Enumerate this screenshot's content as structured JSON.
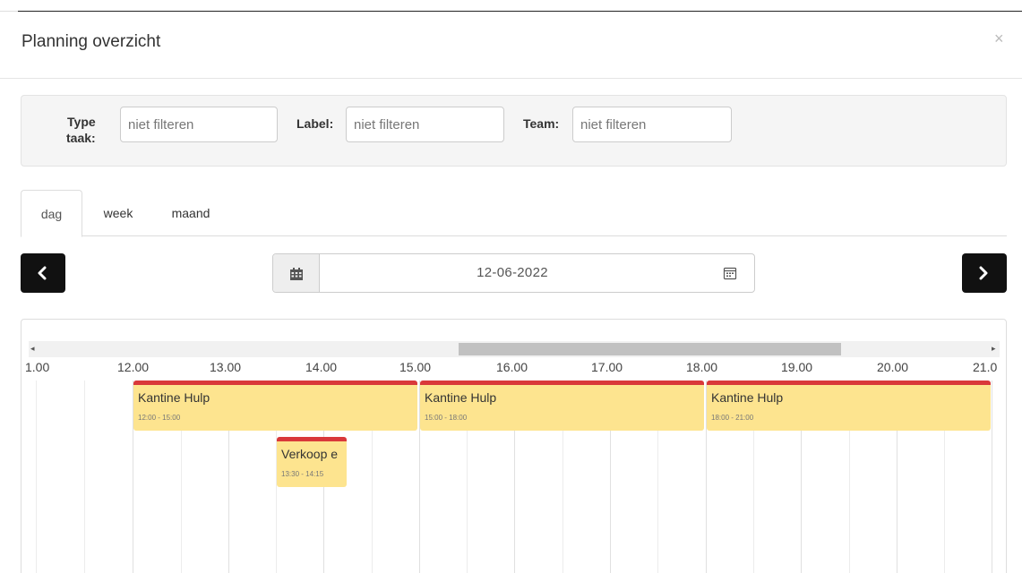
{
  "modal": {
    "title": "Planning overzicht",
    "close_glyph": "×"
  },
  "filters": {
    "type_label_line1": "Type",
    "type_label_line2": "taak:",
    "type_placeholder": "niet filteren",
    "label_label": "Label:",
    "label_placeholder": "niet filteren",
    "team_label": "Team:",
    "team_placeholder": "niet filteren"
  },
  "tabs": [
    {
      "label": "dag",
      "active": true
    },
    {
      "label": "week",
      "active": false
    },
    {
      "label": "maand",
      "active": false
    }
  ],
  "date_nav": {
    "date": "12-06-2022",
    "prev_icon": "chevron-left-icon",
    "next_icon": "chevron-right-icon",
    "calendar_icon": "calendar-icon",
    "datepicker_icon": "calendar-picker-icon"
  },
  "timeline": {
    "scroll_left_glyph": "◂",
    "scroll_right_glyph": "▸",
    "hours": [
      "1.00",
      "12.00",
      "13.00",
      "14.00",
      "15.00",
      "16.00",
      "17.00",
      "18.00",
      "19.00",
      "20.00",
      "21.0"
    ],
    "events": [
      {
        "title": "Kantine Hulp",
        "time": "12:00 - 15:00"
      },
      {
        "title": "Kantine Hulp",
        "time": "15:00 - 18:00"
      },
      {
        "title": "Kantine Hulp",
        "time": "18:00 - 21:00"
      },
      {
        "title": "Verkoop e",
        "time": "13:30 - 14:15"
      }
    ]
  },
  "colors": {
    "event_fill": "#fde48f",
    "event_border": "#d9383a",
    "nav_button": "#111111"
  }
}
